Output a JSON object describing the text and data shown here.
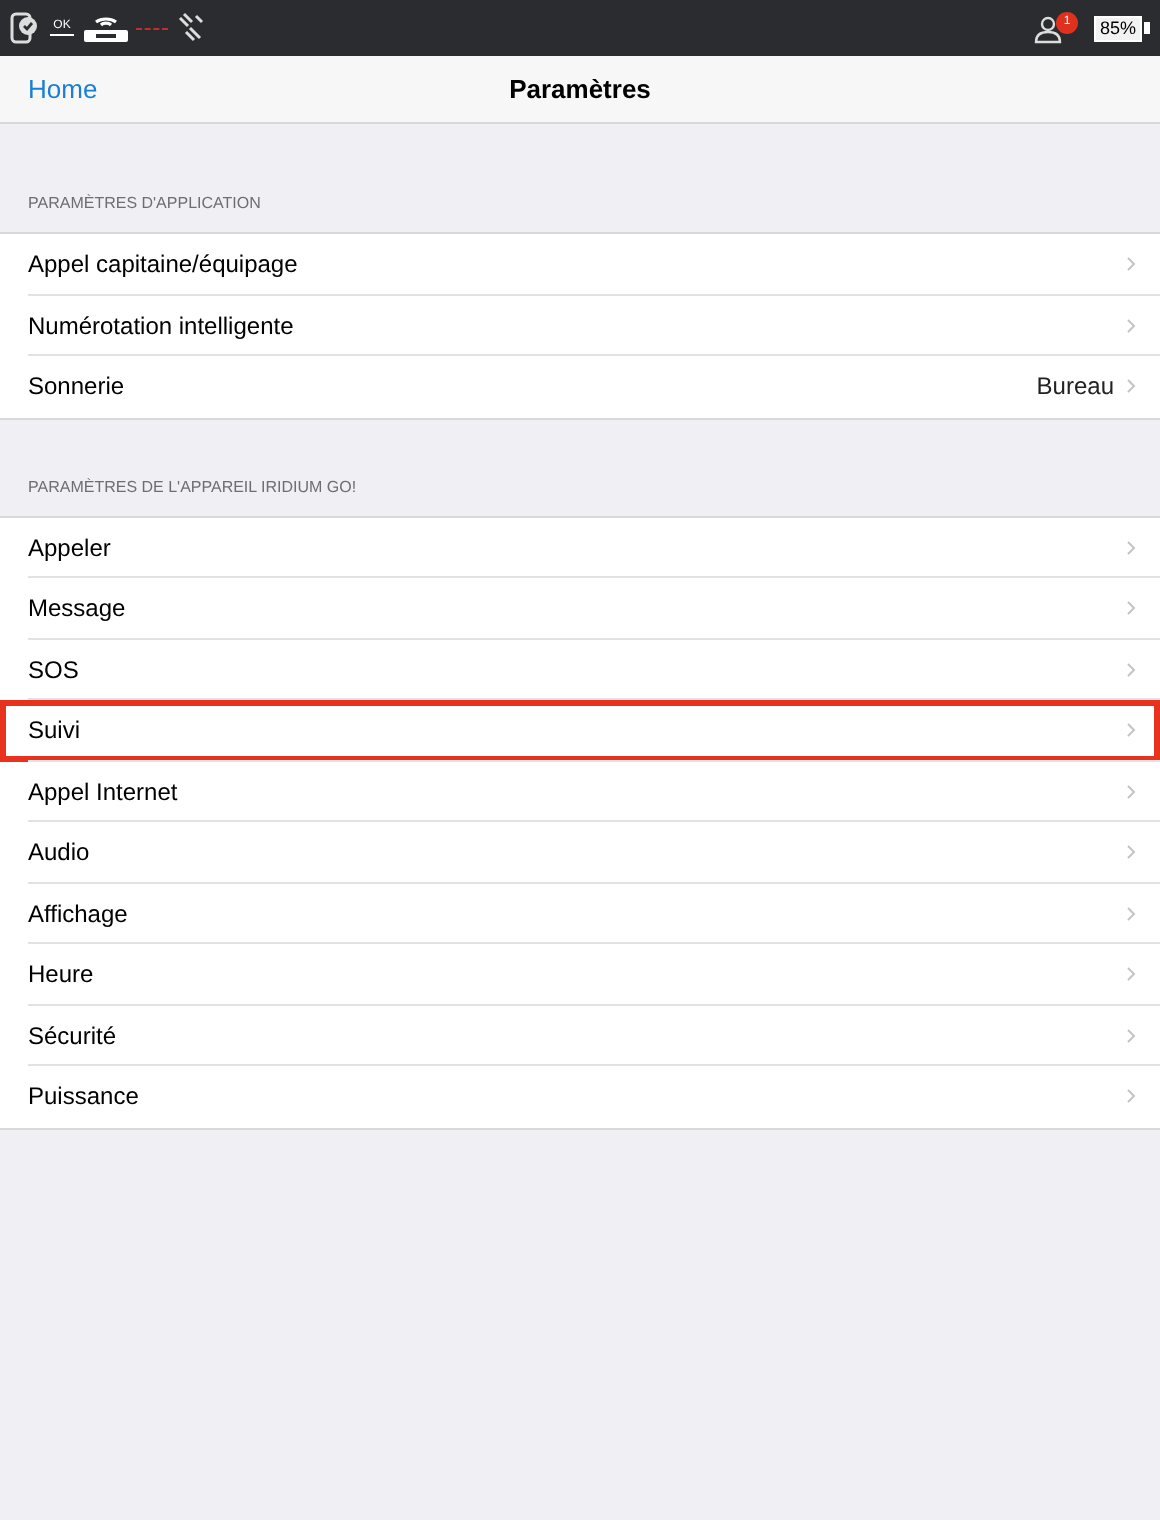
{
  "status_bar": {
    "ok_label": "OK",
    "alert_count": "1",
    "battery": "85%"
  },
  "nav": {
    "back": "Home",
    "title": "Paramètres"
  },
  "sections": [
    {
      "header": "PARAMÈTRES D'APPLICATION",
      "rows": [
        {
          "label": "Appel capitaine/équipage",
          "highlighted": false
        },
        {
          "label": "Numérotation intelligente",
          "highlighted": false
        },
        {
          "label": "Sonnerie",
          "value": "Bureau",
          "highlighted": false
        }
      ]
    },
    {
      "header": "PARAMÈTRES DE L'APPAREIL IRIDIUM GO!",
      "rows": [
        {
          "label": "Appeler",
          "highlighted": false
        },
        {
          "label": "Message",
          "highlighted": false
        },
        {
          "label": "SOS",
          "highlighted": false
        },
        {
          "label": "Suivi",
          "highlighted": true
        },
        {
          "label": "Appel Internet",
          "highlighted": false
        },
        {
          "label": "Audio",
          "highlighted": false
        },
        {
          "label": "Affichage",
          "highlighted": false
        },
        {
          "label": "Heure",
          "highlighted": false
        },
        {
          "label": "Sécurité",
          "highlighted": false
        },
        {
          "label": "Puissance",
          "highlighted": false
        }
      ]
    }
  ]
}
